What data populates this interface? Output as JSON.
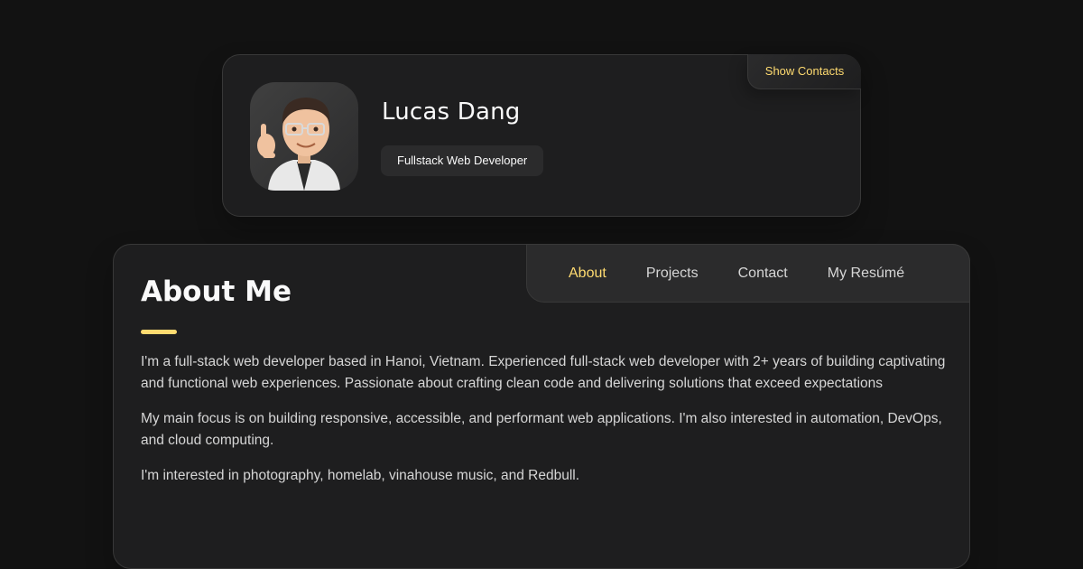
{
  "profile": {
    "name": "Lucas Dang",
    "title": "Fullstack Web Developer",
    "show_contacts_label": "Show Contacts",
    "avatar_icon": "memoji-avatar-icon"
  },
  "nav": {
    "items": [
      {
        "label": "About",
        "active": true
      },
      {
        "label": "Projects",
        "active": false
      },
      {
        "label": "Contact",
        "active": false
      },
      {
        "label": "My Resúmé",
        "active": false
      }
    ]
  },
  "about": {
    "heading": "About Me",
    "paragraphs": [
      "I'm a full-stack web developer based in Hanoi, Vietnam. Experienced full-stack web developer with 2+ years of building captivating and functional web experiences. Passionate about crafting clean code and delivering solutions that exceed expectations",
      "My main focus is on building responsive, accessible, and performant web applications. I'm also interested in automation, DevOps, and cloud computing.",
      "I'm interested in photography, homelab, vinahouse music, and Redbull."
    ]
  },
  "colors": {
    "background": "#121212",
    "card": "#1e1e1f",
    "accent": "#ffdb70",
    "text": "#d6d6d6"
  }
}
